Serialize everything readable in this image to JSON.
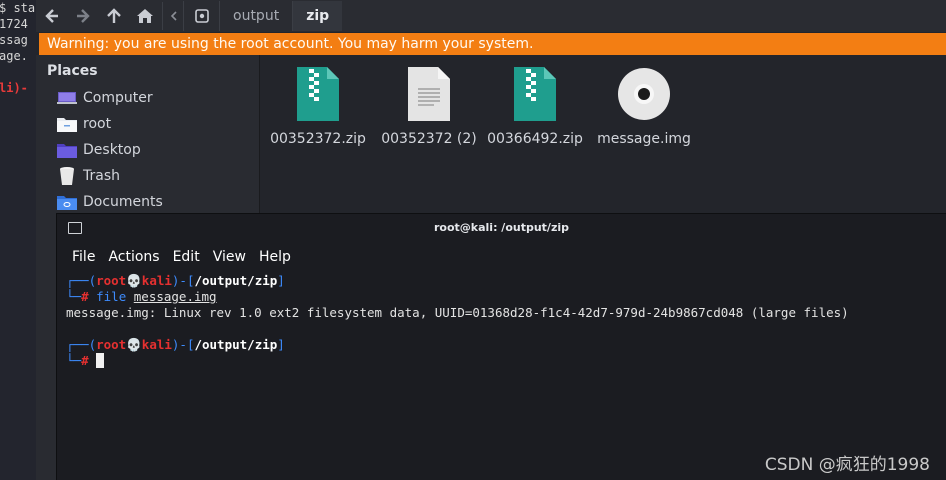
{
  "background_terminal": {
    "lines": [
      "$ sta",
      "1724",
      "ssag",
      "age.",
      "",
      "",
      "li)-"
    ]
  },
  "file_manager": {
    "toolbar": {
      "back_icon": "arrow-left-icon",
      "forward_icon": "arrow-right-icon",
      "up_icon": "arrow-up-icon",
      "home_icon": "home-icon",
      "path": [
        "output",
        "zip"
      ]
    },
    "warning": "Warning: you are using the root account. You may harm your system.",
    "sidebar": {
      "places_heading": "Places",
      "places": [
        {
          "label": "Computer",
          "icon": "computer-icon"
        },
        {
          "label": "root",
          "icon": "home-folder-icon"
        },
        {
          "label": "Desktop",
          "icon": "desktop-folder-icon"
        },
        {
          "label": "Trash",
          "icon": "trash-icon"
        },
        {
          "label": "Documents",
          "icon": "documents-folder-icon"
        }
      ]
    },
    "files": [
      {
        "name": "00352372.zip",
        "icon": "zip-archive-icon"
      },
      {
        "name": "00352372 (2)",
        "icon": "text-document-icon"
      },
      {
        "name": "00366492.zip",
        "icon": "zip-archive-icon"
      },
      {
        "name": "message.img",
        "icon": "disc-image-icon"
      }
    ]
  },
  "terminal": {
    "title": "root@kali: /output/zip",
    "menu": [
      "File",
      "Actions",
      "Edit",
      "View",
      "Help"
    ],
    "prompt_user": "root",
    "prompt_host": "kali",
    "prompt_path": "/output/zip",
    "command_name": "file",
    "command_arg": "message.img",
    "output": "message.img: Linux rev 1.0 ext2 filesystem data, UUID=01368d28-f1c4-42d7-979d-24b9867cd048 (large files)"
  },
  "watermark": "CSDN @疯狂的1998",
  "colors": {
    "warning_bg": "#f37e13",
    "prompt_blue": "#3d8bfd",
    "prompt_red": "#e53030"
  }
}
